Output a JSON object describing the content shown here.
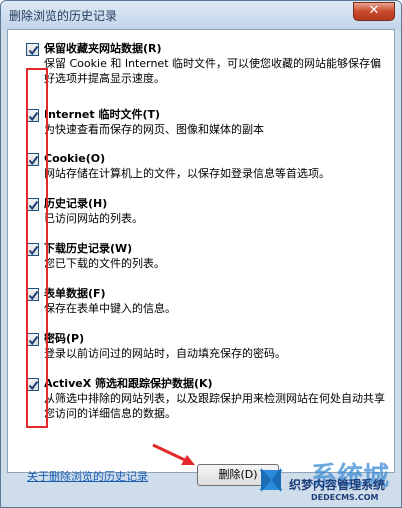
{
  "window": {
    "title": "删除浏览的历史记录",
    "close_label": "✕"
  },
  "options": [
    {
      "label": "保留收藏夹网站数据(R)",
      "desc": "保留 Cookie 和 Internet 临时文件，可以使您收藏的网站能够保存偏好选项并提高显示速度。",
      "checked": true
    },
    {
      "label": "Internet 临时文件(T)",
      "desc": "为快速查看而保存的网页、图像和媒体的副本",
      "checked": true
    },
    {
      "label": "Cookie(O)",
      "desc": "网站存储在计算机上的文件，以保存如登录信息等首选项。",
      "checked": true
    },
    {
      "label": "历史记录(H)",
      "desc": "已访问网站的列表。",
      "checked": true
    },
    {
      "label": "下载历史记录(W)",
      "desc": "您已下载的文件的列表。",
      "checked": true
    },
    {
      "label": "表单数据(F)",
      "desc": "保存在表单中键入的信息。",
      "checked": true
    },
    {
      "label": "密码(P)",
      "desc": "登录以前访问过的网站时，自动填充保存的密码。",
      "checked": true
    },
    {
      "label": "ActiveX 筛选和跟踪保护数据(K)",
      "desc": "从筛选中排除的网站列表，以及跟踪保护用来检测网站在何处自动共享您访问的详细信息的数据。",
      "checked": true
    }
  ],
  "footer": {
    "link": "关于删除浏览的历史记录",
    "delete_label": "删除(D)"
  },
  "watermark": {
    "big": "系统城",
    "line1": "织梦内容管理系统",
    "line2": "DEDECMS.COM"
  },
  "colors": {
    "highlight_red": "#e2282a",
    "link_blue": "#1a5fb4",
    "title_text": "#1e395b"
  }
}
